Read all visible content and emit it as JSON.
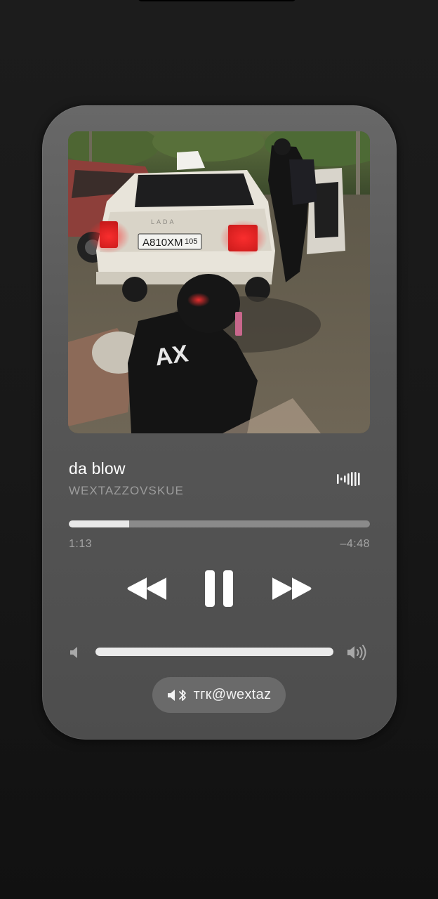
{
  "player": {
    "track_title": "da blow",
    "artist": "WEXTAZZOVSKUE",
    "elapsed": "1:13",
    "remaining": "–4:48",
    "progress_fraction": 0.2,
    "volume_fraction": 1.0,
    "artwork": {
      "plate_text": "A810XM",
      "plate_region": "105",
      "brand_text": "LADA",
      "hoodie_text": "AX"
    },
    "airplay_icon": "audio-waveform-icon",
    "output_pill": {
      "label": "тгк@wextaz",
      "icon": "speaker-bluetooth-icon"
    }
  },
  "controls": {
    "rewind_icon": "rewind-icon",
    "pause_icon": "pause-icon",
    "forward_icon": "fast-forward-icon",
    "volume_low_icon": "volume-low-icon",
    "volume_high_icon": "volume-high-icon"
  },
  "colors": {
    "card": "#575757",
    "progress_fill": "#e9e9e9",
    "progress_track": "#8a8a8a",
    "text_primary": "#ffffff",
    "text_secondary": "#9c9c9c"
  }
}
